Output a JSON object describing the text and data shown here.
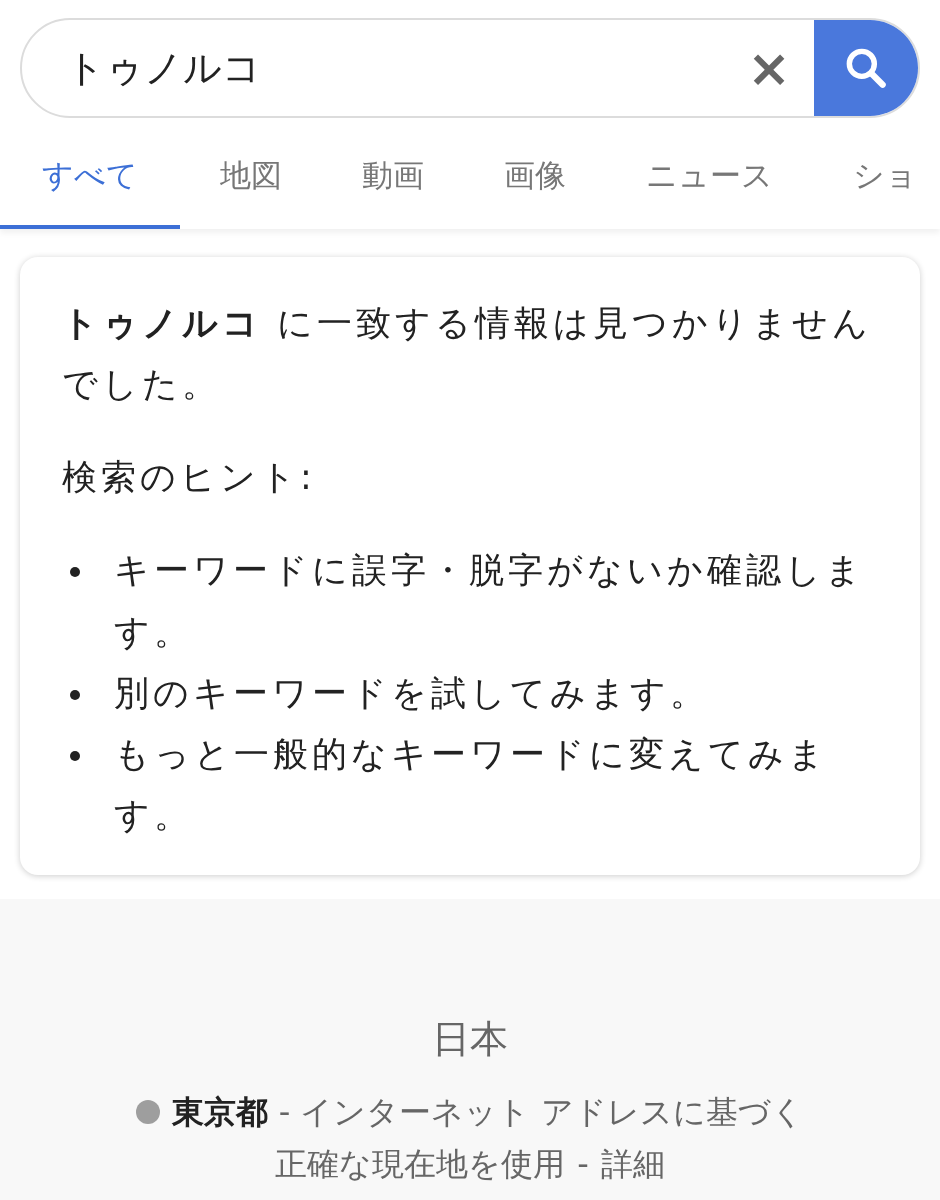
{
  "search": {
    "value": "トゥノルコ",
    "clear_label": "×"
  },
  "tabs": [
    {
      "label": "すべて",
      "selected": true
    },
    {
      "label": "地図",
      "selected": false
    },
    {
      "label": "動画",
      "selected": false
    },
    {
      "label": "画像",
      "selected": false
    },
    {
      "label": "ニュース",
      "selected": false
    },
    {
      "label": "ショ",
      "selected": false
    }
  ],
  "result_card": {
    "message": "**トゥノルコ** に一致する情報は見つかりませんでした。",
    "hints_heading": "検索のヒント:",
    "hints": [
      "キーワードに誤字・脱字がないか確認します。",
      "別のキーワードを試してみます。",
      "もっと一般的なキーワードに変えてみます。"
    ]
  },
  "footer": {
    "country": "日本",
    "location": "**東京都** - インターネット アドレスに基づく",
    "links": [
      "正確な現在地を使用",
      "詳細"
    ],
    "separator": "-"
  }
}
